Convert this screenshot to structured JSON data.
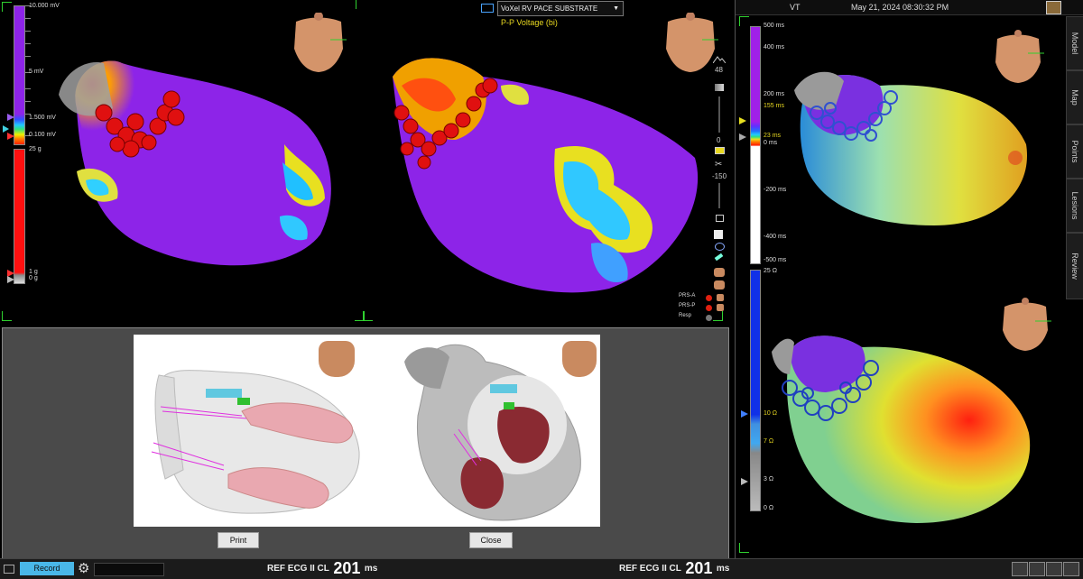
{
  "left_view": {
    "voltage_scale": {
      "max": "10.000 mV",
      "mid": "5 mV",
      "high": "1.500 mV",
      "low": "0.100 mV"
    },
    "force_scale": {
      "top": "25 g",
      "mid": "1 g",
      "bottom": "0 g"
    },
    "map_selector": {
      "value": "VoXel RV PACE SUBSTRATE"
    },
    "map_subtitle": "P-P Voltage (bi)",
    "tool_values": {
      "zoom": "48",
      "opacity": "0",
      "clip": "-150"
    },
    "legend": [
      {
        "label": "PRS-A",
        "color": "#e02010"
      },
      {
        "label": "PRS-P",
        "color": "#e02010"
      },
      {
        "label": "Resp",
        "color": "#777777"
      }
    ]
  },
  "dialog": {
    "print_label": "Print",
    "close_label": "Close"
  },
  "right_view": {
    "header": {
      "label": "VT",
      "timestamp": "May 21, 2024 08:30:32 PM"
    },
    "lat_scale": {
      "t1": "500 ms",
      "t2": "400 ms",
      "t3": "200 ms",
      "high": "155 ms",
      "low": "23 ms",
      "zero": "0 ms",
      "n1": "-200 ms",
      "n2": "-400 ms",
      "n3": "-500 ms"
    },
    "imp_scale": {
      "top": "25 Ω",
      "mid": "10 Ω",
      "lower": "7 Ω",
      "low": "3 Ω",
      "bottom": "0 Ω"
    },
    "side_tabs": [
      "Model",
      "Map",
      "Points",
      "Lesions",
      "Review"
    ]
  },
  "bottom_bar": {
    "record_label": "Record",
    "ecg_left": {
      "label": "REF ECG II CL",
      "value": "201",
      "unit": "ms"
    },
    "ecg_right": {
      "label": "REF ECG II CL",
      "value": "201",
      "unit": "ms"
    }
  },
  "colors": {
    "accent": "#2fd12f",
    "record_bg": "#49b7e8",
    "primary_button": "#e6e6e6"
  }
}
